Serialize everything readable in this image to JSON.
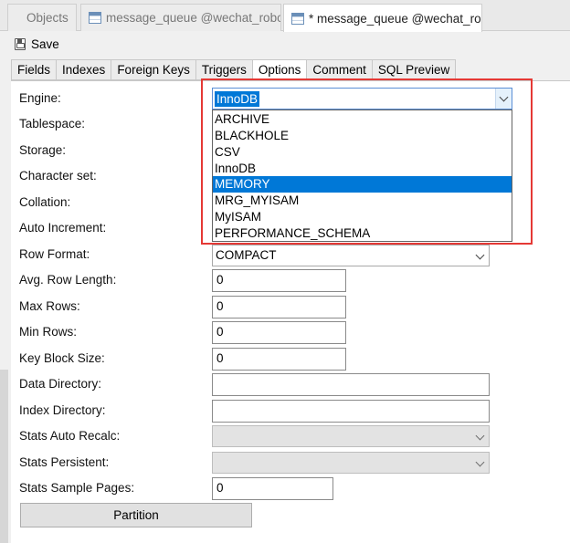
{
  "tabs": [
    {
      "label": "Objects",
      "active": false
    },
    {
      "label": "message_queue @wechat_robo...",
      "active": false
    },
    {
      "label": "* message_queue @wechat_ro...",
      "active": true
    }
  ],
  "toolbar": {
    "save_label": "Save"
  },
  "subtabs": [
    {
      "label": "Fields",
      "active": false
    },
    {
      "label": "Indexes",
      "active": false
    },
    {
      "label": "Foreign Keys",
      "active": false
    },
    {
      "label": "Triggers",
      "active": false
    },
    {
      "label": "Options",
      "active": true
    },
    {
      "label": "Comment",
      "active": false
    },
    {
      "label": "SQL Preview",
      "active": false
    }
  ],
  "options": {
    "labels": {
      "engine": "Engine:",
      "tablespace": "Tablespace:",
      "storage": "Storage:",
      "charset": "Character set:",
      "collation": "Collation:",
      "auto_increment": "Auto Increment:",
      "row_format": "Row Format:",
      "avg_row_length": "Avg. Row Length:",
      "max_rows": "Max Rows:",
      "min_rows": "Min Rows:",
      "key_block_size": "Key Block Size:",
      "data_directory": "Data Directory:",
      "index_directory": "Index Directory:",
      "stats_auto_recalc": "Stats Auto Recalc:",
      "stats_persistent": "Stats Persistent:",
      "stats_sample_pages": "Stats Sample Pages:"
    },
    "engine_value": "InnoDB",
    "engine_options": [
      "ARCHIVE",
      "BLACKHOLE",
      "CSV",
      "InnoDB",
      "MEMORY",
      "MRG_MYISAM",
      "MyISAM",
      "PERFORMANCE_SCHEMA"
    ],
    "engine_highlighted": "MEMORY",
    "row_format_value": "COMPACT",
    "avg_row_length": "0",
    "max_rows": "0",
    "min_rows": "0",
    "key_block_size": "0",
    "data_directory": "",
    "index_directory": "",
    "stats_auto_recalc": "",
    "stats_persistent": "",
    "stats_sample_pages": "0",
    "partition_label": "Partition"
  },
  "colors": {
    "selection": "#0078d7",
    "callout": "#e53935"
  }
}
